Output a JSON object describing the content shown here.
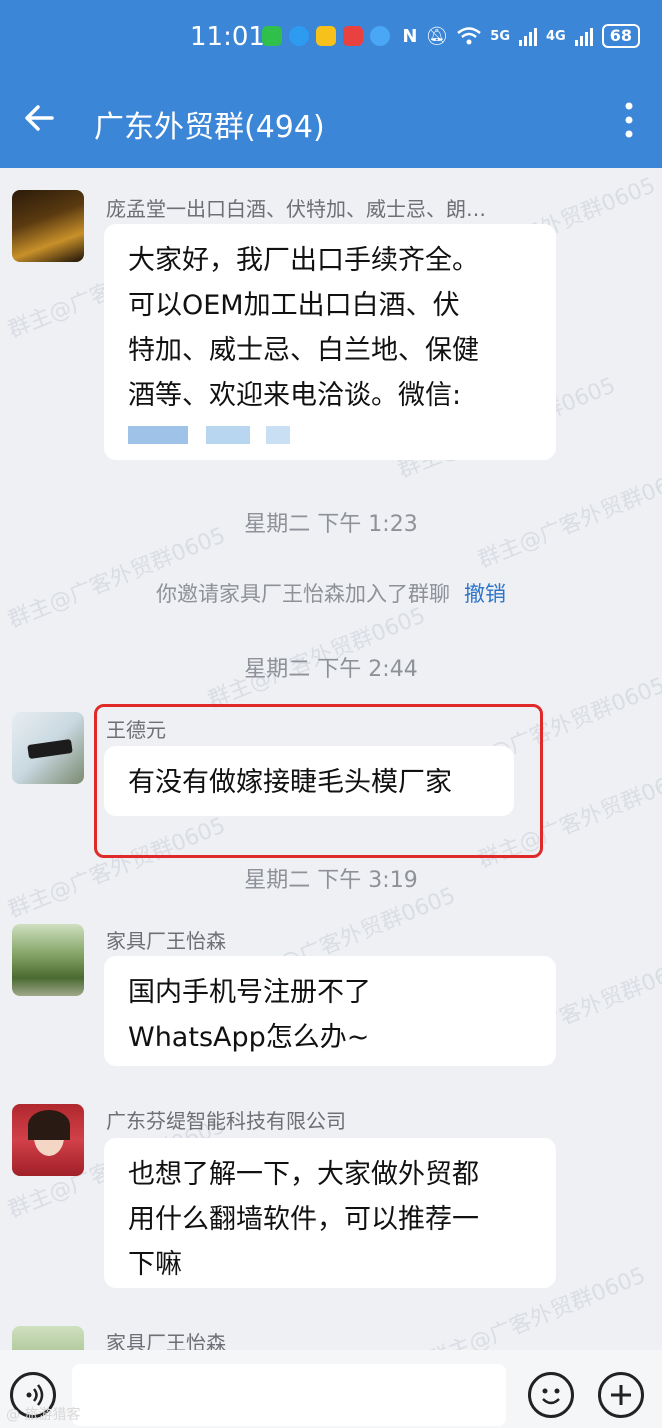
{
  "status_bar": {
    "time": "11:01",
    "network_1": "5G",
    "network_2": "4G",
    "battery": "68",
    "notification_icons": [
      "wechat-icon",
      "download-icon",
      "mail-icon",
      "message-icon",
      "cloud-icon"
    ],
    "system_icons": [
      "nfc-icon",
      "mute-icon",
      "wifi-icon",
      "signal-icon",
      "signal-icon"
    ]
  },
  "header": {
    "title": "广东外贸群(494)",
    "back_icon": "arrow-left-icon",
    "more_icon": "more-vertical-icon"
  },
  "colors": {
    "header_bg": "#3c86d8",
    "chat_bg": "#eef0f4",
    "bubble_bg": "#ffffff",
    "highlight_border": "#e02a2a",
    "link": "#2f74c9"
  },
  "watermark": "群主@广客外贸群0605",
  "messages": [
    {
      "sender": "庞孟堂一出口白酒、伏特加、威士忌、朗…",
      "lines": [
        "大家好，我厂出口手续齐全。",
        "可以OEM加工出口白酒、伏",
        "特加、威士忌、白兰地、保健",
        "酒等、欢迎来电洽谈。微信:"
      ],
      "redacted": true
    },
    {
      "sender": "王德元",
      "lines": [
        "有没有做嫁接睫毛头模厂家"
      ]
    },
    {
      "sender": "家具厂王怡森",
      "lines": [
        "国内手机号注册不了",
        "WhatsApp怎么办~"
      ]
    },
    {
      "sender": "广东芬缇智能科技有限公司",
      "lines": [
        "也想了解一下，大家做外贸都",
        "用什么翻墙软件，可以推荐一",
        "下嘛"
      ]
    },
    {
      "sender": "家具厂王怡森",
      "lines": []
    }
  ],
  "timestamps": [
    "星期二  下午 1:23",
    "星期二  下午 2:44",
    "星期二  下午 3:19"
  ],
  "system_message": {
    "text": "你邀请家具厂王怡森加入了群聊",
    "action": "撤销"
  },
  "input_bar": {
    "placeholder": "",
    "voice_icon": "voice-icon",
    "emoji_icon": "emoji-icon",
    "plus_icon": "plus-icon"
  },
  "source_mark": "@ 旅游猎客"
}
